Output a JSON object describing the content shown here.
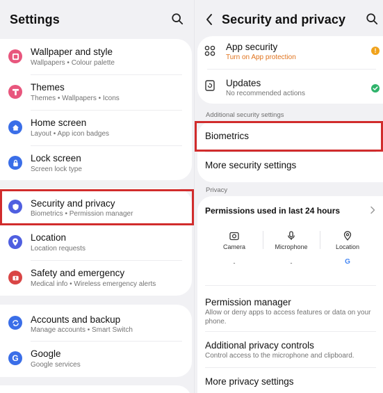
{
  "left": {
    "title": "Settings",
    "groups": [
      [
        {
          "title": "Wallpaper and style",
          "subtitle": "Wallpapers  •  Colour palette",
          "icon": "palette-icon",
          "color": "#e8567d"
        },
        {
          "title": "Themes",
          "subtitle": "Themes  •  Wallpapers  •  Icons",
          "icon": "themes-icon",
          "color": "#e8567d"
        },
        {
          "title": "Home screen",
          "subtitle": "Layout  •  App icon badges",
          "icon": "home-icon",
          "color": "#3a6ee8"
        },
        {
          "title": "Lock screen",
          "subtitle": "Screen lock type",
          "icon": "lock-icon",
          "color": "#3a6ee8"
        }
      ],
      [
        {
          "title": "Security and privacy",
          "subtitle": "Biometrics  •  Permission manager",
          "icon": "shield-icon",
          "color": "#4f5fe0"
        },
        {
          "title": "Location",
          "subtitle": "Location requests",
          "icon": "location-icon",
          "color": "#4f5fe0"
        },
        {
          "title": "Safety and emergency",
          "subtitle": "Medical info  •  Wireless emergency alerts",
          "icon": "emergency-icon",
          "color": "#d94545"
        }
      ],
      [
        {
          "title": "Accounts and backup",
          "subtitle": "Manage accounts  •  Smart Switch",
          "icon": "sync-icon",
          "color": "#3a6ee8"
        },
        {
          "title": "Google",
          "subtitle": "Google services",
          "icon": "google-icon",
          "color": "#3a6ee8"
        }
      ]
    ]
  },
  "right": {
    "title": "Security and privacy",
    "top_items": [
      {
        "title": "App security",
        "subtitle": "Turn on App protection",
        "subtitle_color": "#e0731d",
        "status": "warning",
        "status_color": "#f0a21c"
      },
      {
        "title": "Updates",
        "subtitle": "No recommended actions",
        "subtitle_color": "#737373",
        "status": "ok",
        "status_color": "#2fb36b"
      }
    ],
    "additional_header": "Additional security settings",
    "additional_items": [
      "Biometrics",
      "More security settings"
    ],
    "privacy_header": "Privacy",
    "permissions": {
      "title": "Permissions used in last 24 hours",
      "items": [
        {
          "label": "Camera",
          "value": "-",
          "icon": "camera-icon"
        },
        {
          "label": "Microphone",
          "value": "-",
          "icon": "microphone-icon"
        },
        {
          "label": "Location",
          "value": "G",
          "icon": "location-pin-icon"
        }
      ]
    },
    "privacy_items": [
      {
        "title": "Permission manager",
        "subtitle": "Allow or deny apps to access features or data on your phone."
      },
      {
        "title": "Additional privacy controls",
        "subtitle": "Control access to the microphone and clipboard."
      },
      {
        "title": "More privacy settings",
        "subtitle": ""
      }
    ]
  }
}
